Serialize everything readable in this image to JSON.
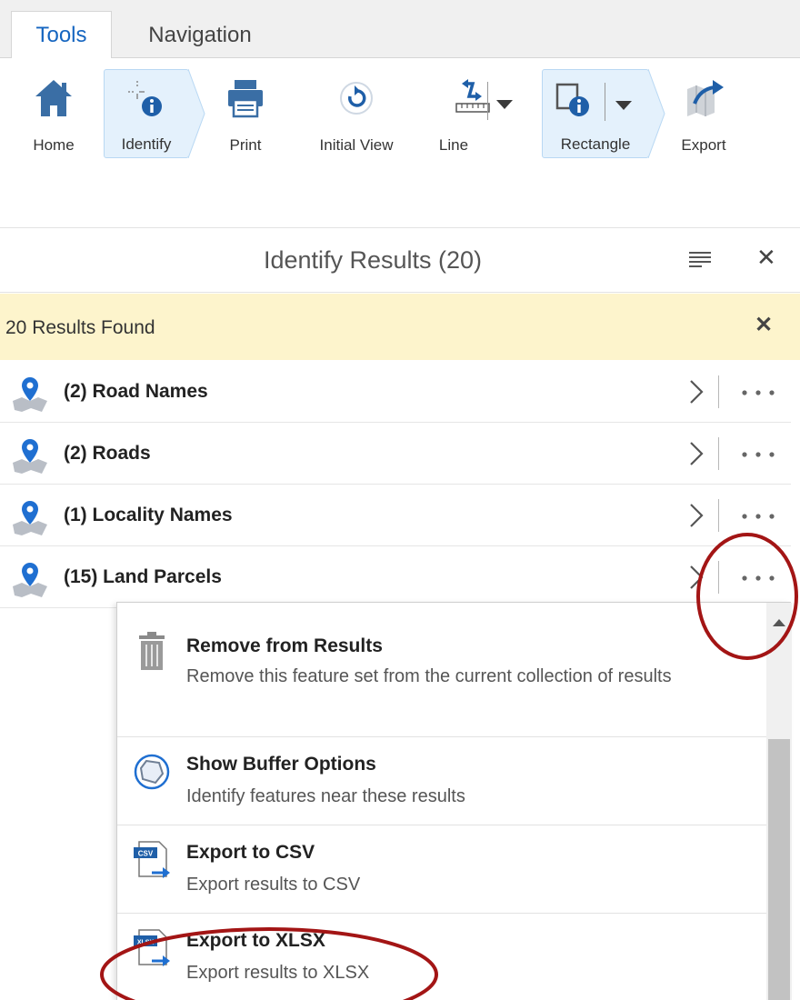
{
  "ribbon": {
    "tabs": [
      {
        "label": "Tools",
        "active": true
      },
      {
        "label": "Navigation",
        "active": false
      }
    ],
    "tools": {
      "home": {
        "label": "Home",
        "icon": "home-icon"
      },
      "identify": {
        "label": "Identify",
        "icon": "identify-icon",
        "selected": true
      },
      "print": {
        "label": "Print",
        "icon": "printer-icon"
      },
      "initial_view": {
        "label": "Initial View",
        "icon": "refresh-icon"
      },
      "line": {
        "label": "Line",
        "icon": "measure-line-icon"
      },
      "rectangle": {
        "label": "Rectangle",
        "icon": "rectangle-identify-icon",
        "selected": true
      },
      "export": {
        "label": "Export",
        "icon": "export-map-icon"
      }
    }
  },
  "panel": {
    "title": "Identify Results (20)",
    "banner": "20 Results Found",
    "results": [
      {
        "label": "(2) Road Names",
        "icon": "layer-pin-icon"
      },
      {
        "label": "(2) Roads",
        "icon": "layer-pin-icon"
      },
      {
        "label": "(1) Locality Names",
        "icon": "layer-pin-icon"
      },
      {
        "label": "(15) Land Parcels",
        "icon": "layer-pin-icon"
      }
    ]
  },
  "context_menu": {
    "items": [
      {
        "title": "Remove from Results",
        "description": "Remove this feature set from the current collection of results",
        "icon": "trash-icon"
      },
      {
        "title": "Show Buffer Options",
        "description": "Identify features near these results",
        "icon": "buffer-icon"
      },
      {
        "title": "Export to CSV",
        "description": "Export results to CSV",
        "icon": "csv-export-icon",
        "badge": "CSV"
      },
      {
        "title": "Export to XLSX",
        "description": "Export results to XLSX",
        "icon": "xlsx-export-icon",
        "badge": "XLSX"
      }
    ]
  },
  "colors": {
    "accent": "#1565c0",
    "selected_bg": "#e4f1fc",
    "banner_bg": "#fdf4cc",
    "annotation": "#a31515"
  }
}
